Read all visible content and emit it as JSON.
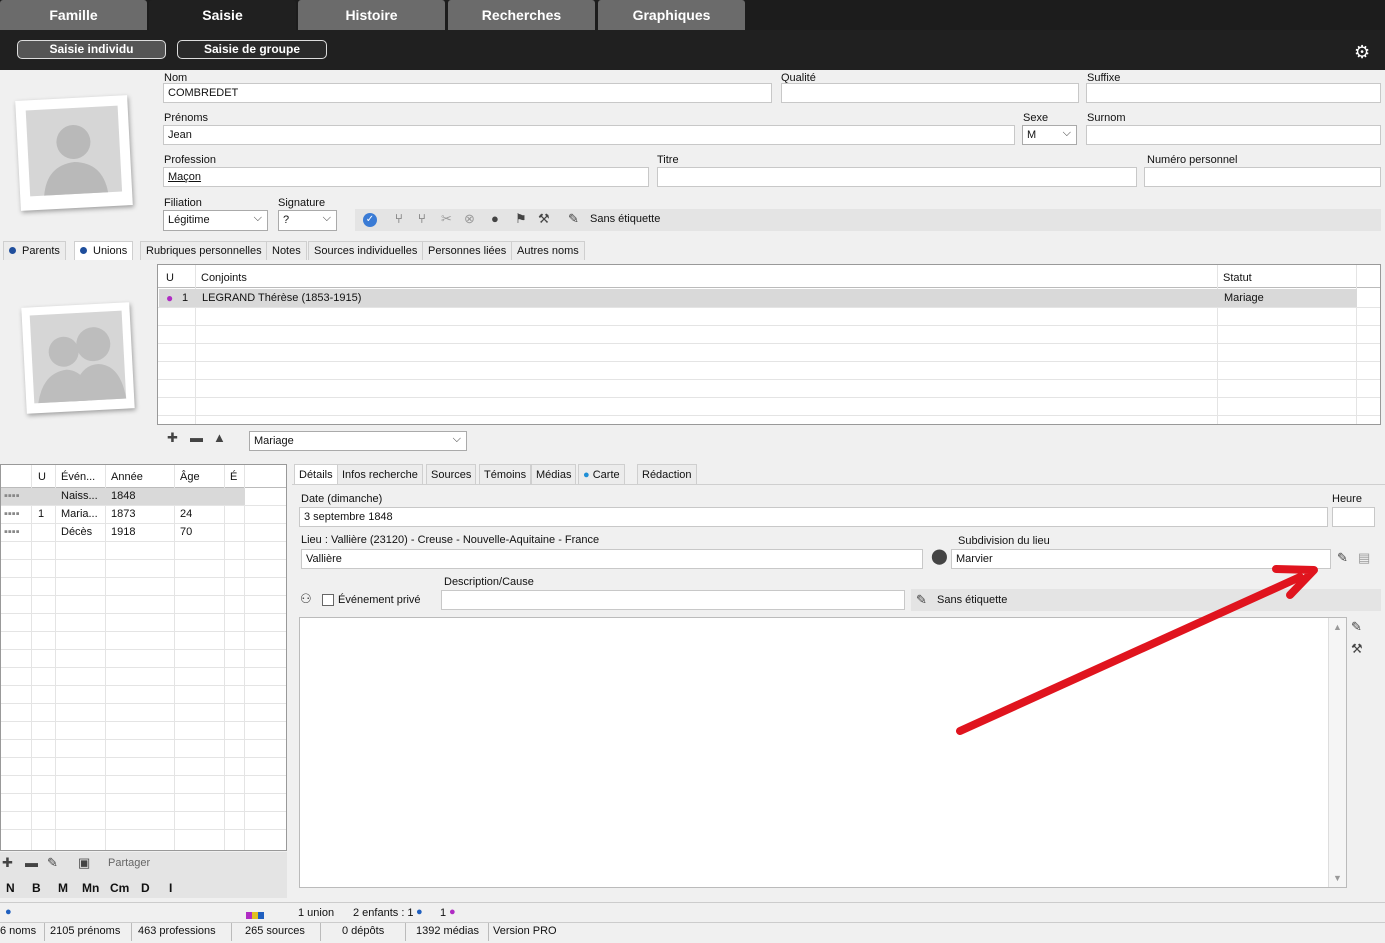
{
  "tabs": [
    "Famille",
    "Saisie",
    "Histoire",
    "Recherches",
    "Graphiques"
  ],
  "subtabs": {
    "individu": "Saisie individu",
    "groupe": "Saisie de groupe"
  },
  "identity": {
    "nom_label": "Nom",
    "nom": "COMBREDET",
    "qualite_label": "Qualité",
    "qualite": "",
    "suffixe_label": "Suffixe",
    "suffixe": "",
    "prenoms_label": "Prénoms",
    "prenoms": "Jean",
    "sexe_label": "Sexe",
    "sexe": "M",
    "surnom_label": "Surnom",
    "surnom": "",
    "profession_label": "Profession",
    "profession": "Maçon",
    "titre_label": "Titre",
    "titre": "",
    "numero_label": "Numéro personnel",
    "numero": "",
    "filiation_label": "Filiation",
    "filiation": "Légitime",
    "signature_label": "Signature",
    "signature": "?",
    "etiquette": "Sans étiquette"
  },
  "section_tabs": [
    "Parents",
    "Unions",
    "Rubriques personnelles",
    "Notes",
    "Sources individuelles",
    "Personnes liées",
    "Autres noms"
  ],
  "unions": {
    "headers": [
      "U",
      "Conjoints",
      "Statut"
    ],
    "rows": [
      {
        "u": "1",
        "conjoint": "LEGRAND Thérèse (1853-1915)",
        "statut": "Mariage"
      }
    ],
    "type": "Mariage"
  },
  "events": {
    "headers": [
      "U",
      "Évén...",
      "Année",
      "Âge",
      "É"
    ],
    "rows": [
      {
        "u": "",
        "evt": "Naiss...",
        "annee": "1848",
        "age": ""
      },
      {
        "u": "1",
        "evt": "Maria...",
        "annee": "1873",
        "age": "24"
      },
      {
        "u": "",
        "evt": "Décès",
        "annee": "1918",
        "age": "70"
      }
    ],
    "partager": "Partager",
    "letters": [
      "N",
      "B",
      "M",
      "Mn",
      "Cm",
      "D",
      "I"
    ]
  },
  "event_tabs": [
    "Détails",
    "Infos recherche",
    "Sources",
    "Témoins",
    "Médias",
    "Carte",
    "Rédaction"
  ],
  "details": {
    "date_label": "Date (dimanche)",
    "date": "3 septembre 1848",
    "heure_label": "Heure",
    "heure": "",
    "lieu_label": "Lieu : Vallière (23120) - Creuse - Nouvelle-Aquitaine - France",
    "lieu": "Vallière",
    "subdivision_label": "Subdivision du lieu",
    "subdivision": "Marvier",
    "prive": "Événement privé",
    "description_label": "Description/Cause",
    "description": "",
    "etiquette": "Sans étiquette"
  },
  "status_row1": {
    "unions": "1 union",
    "enfants": "2 enfants : 1",
    "filles": "1"
  },
  "status_row2": [
    "6 noms",
    "2105 prénoms",
    "463 professions",
    "265 sources",
    "0 dépôts",
    "1392 médias",
    "Version PRO"
  ],
  "colors": {
    "tabbar": "#1c1c1c",
    "tab": "#6b6b6b",
    "arrow": "#e0141e",
    "male": "#1f5fbf",
    "female": "#b02cc4"
  }
}
